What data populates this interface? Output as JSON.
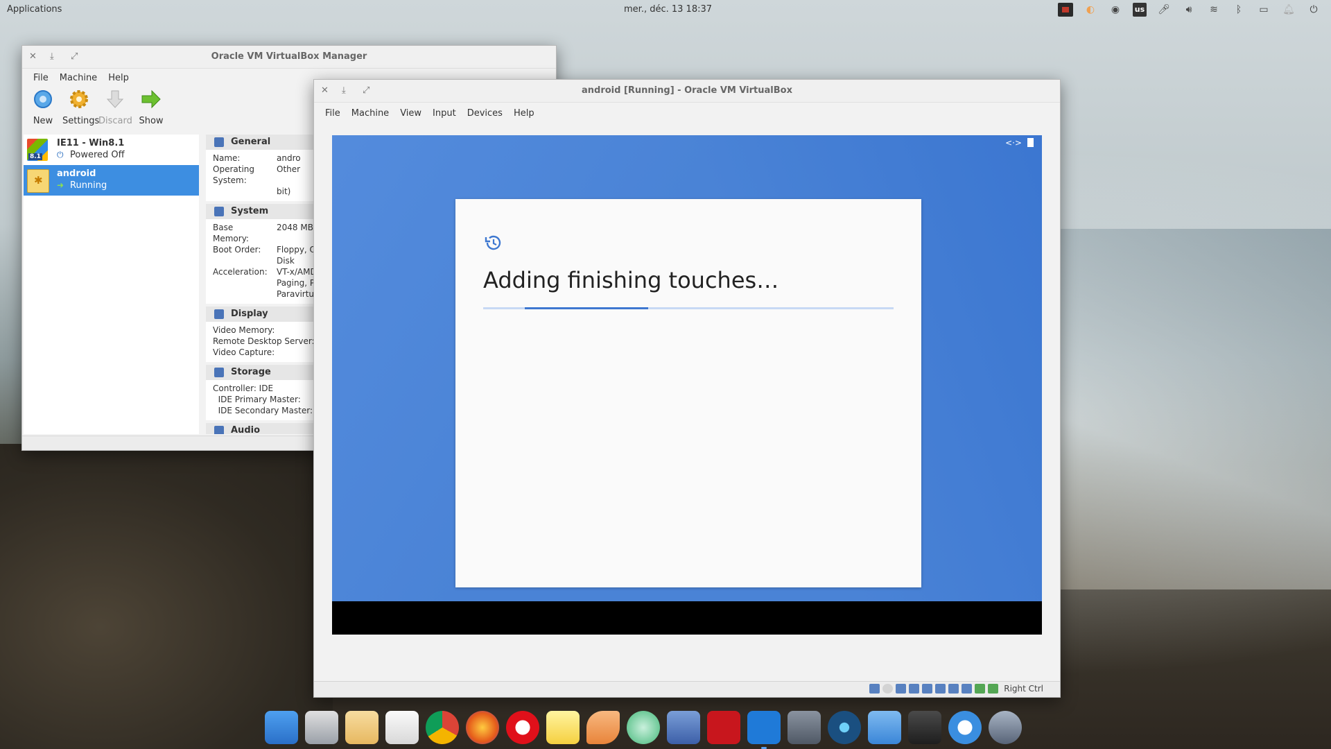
{
  "desktop": {
    "top_panel": {
      "applications_label": "Applications",
      "clock": "mer., déc. 13    18:37",
      "keyboard_layout": "us",
      "tray_icons": [
        "screen-recorder-icon",
        "night-light-icon",
        "steam-icon",
        "keyboard-layout-icon",
        "microphone-icon",
        "volume-icon",
        "wifi-icon",
        "bluetooth-icon",
        "battery-icon",
        "notifications-icon",
        "power-icon"
      ]
    },
    "dock_icons": [
      "multitasking-view-icon",
      "files-icon",
      "mail-icon",
      "calendar-icon",
      "chrome-icon",
      "firefox-icon",
      "opera-icon",
      "notes-icon",
      "slack-icon",
      "atom-icon",
      "appcenter-icon",
      "filezilla-icon",
      "activity-monitor-icon",
      "system-settings-icon",
      "react-icon",
      "dropbox-icon",
      "screenshot-icon",
      "cloud-icon",
      "steam-icon"
    ]
  },
  "manager": {
    "title": "Oracle VM VirtualBox Manager",
    "menu": [
      "File",
      "Machine",
      "Help"
    ],
    "toolbar": [
      {
        "label": "New",
        "icon": "new-vm-icon",
        "enabled": true
      },
      {
        "label": "Settings",
        "icon": "gear-icon",
        "enabled": true
      },
      {
        "label": "Discard",
        "icon": "discard-arrow-icon",
        "enabled": false
      },
      {
        "label": "Show",
        "icon": "show-arrow-icon",
        "enabled": true
      }
    ],
    "vms": [
      {
        "name": "IE11 - Win8.1",
        "state": "Powered Off",
        "badge": "8.1"
      },
      {
        "name": "android",
        "state": "Running"
      }
    ],
    "details": {
      "general": {
        "header": "General",
        "rows": [
          [
            "Name:",
            "andro"
          ],
          [
            "Operating System:",
            "Other"
          ],
          [
            "",
            "bit)"
          ]
        ]
      },
      "system": {
        "header": "System",
        "rows": [
          [
            "Base",
            "2048 MB"
          ],
          [
            "Memory:",
            ""
          ],
          [
            "Boot Order:",
            "Floppy, O"
          ],
          [
            "",
            "Disk"
          ],
          [
            "Acceleration:",
            "VT-x/AMD"
          ],
          [
            "",
            "Paging, PA"
          ],
          [
            "",
            "Paravirtua"
          ]
        ]
      },
      "display": {
        "header": "Display",
        "rows": [
          [
            "Video Memory:",
            ""
          ],
          [
            "Remote Desktop Server:",
            ""
          ],
          [
            "Video Capture:",
            ""
          ]
        ]
      },
      "storage": {
        "header": "Storage",
        "rows": [
          [
            "Controller: IDE",
            ""
          ],
          [
            "  IDE Primary Master:",
            ""
          ],
          [
            "  IDE Secondary Master:",
            ""
          ]
        ]
      },
      "audio": {
        "header": "Audio"
      }
    }
  },
  "vbox": {
    "title": "android [Running] - Oracle VM VirtualBox",
    "menu": [
      "File",
      "Machine",
      "View",
      "Input",
      "Devices",
      "Help"
    ],
    "guest": {
      "headline": "Adding finishing touches…",
      "progress": 0.3
    },
    "host_key": "Right Ctrl"
  }
}
